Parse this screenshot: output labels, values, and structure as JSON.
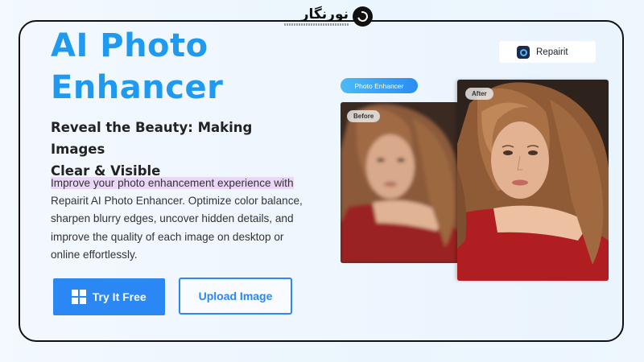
{
  "hero": {
    "title_line1": "AI Photo",
    "title_line2": "Enhancer",
    "subtitle_line1": "Reveal the Beauty: Making Images",
    "subtitle_line2": "Clear & Visible",
    "description": [
      "Improve your photo enhancement experience with",
      "Repairit AI Photo Enhancer. Optimize color balance,",
      "sharpen blurry edges, uncover hidden details, and",
      "improve the quality of each image on desktop or",
      "online effortlessly."
    ]
  },
  "actions": {
    "try_free_label": "Try It Free",
    "upload_label": "Upload Image"
  },
  "preview": {
    "pill_label": "Photo Enhancer",
    "before_label": "Before",
    "after_label": "After"
  },
  "brand": {
    "name": "Repairit",
    "icon": "repairit-logo-icon"
  },
  "watermark": {
    "text": "نورنگار"
  },
  "colors": {
    "accent": "#2a87f3",
    "title": "#1e9af0",
    "highlight": "#ead6f7"
  }
}
